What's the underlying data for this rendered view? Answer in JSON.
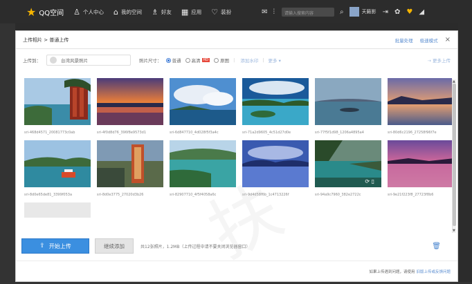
{
  "topbar": {
    "brand": "QQ空间",
    "items": [
      {
        "icon": "person-icon",
        "label": "个人中心"
      },
      {
        "icon": "home-icon",
        "label": "我的空间"
      },
      {
        "icon": "friends-icon",
        "label": "好友"
      },
      {
        "icon": "apps-icon",
        "label": "应用"
      },
      {
        "icon": "heart-outline-icon",
        "label": "装扮"
      }
    ],
    "search_placeholder": "请输入搜索内容",
    "user_name": "天籁影"
  },
  "dialog": {
    "breadcrumb": "上传相片 > 普通上传",
    "head_links": [
      "批量处理",
      "极速模式"
    ],
    "close_label": "×",
    "options": {
      "upload_to_label": "上传到：",
      "album_name": "台湾风景照片",
      "size_label": "照片尺寸：",
      "radios": [
        {
          "label": "普通",
          "selected": true
        },
        {
          "label": "高清",
          "badge": "HD",
          "selected": false
        },
        {
          "label": "原图",
          "selected": false
        }
      ],
      "link1": "添加水印",
      "link2": "更多",
      "more_upload": "更多上传"
    },
    "photos": [
      {
        "name": "sri-468d4571_20081773c0ab"
      },
      {
        "name": "sri-4f0d8d76_396f8e9573d1"
      },
      {
        "name": "sri-6d847710_4d028f5f3a4c"
      },
      {
        "name": "sri-71a2d9605_4c51d27d0e"
      },
      {
        "name": "sri-77f5f1d98_1206a4895a4"
      },
      {
        "name": "sri-80d6c2196_27258f96f7e"
      },
      {
        "name": "sri-8d0e65de81_3399f053a"
      },
      {
        "name": "sri-8d0e3775_27020d3b26"
      },
      {
        "name": "sri-82907710_4f5f4058a6c"
      },
      {
        "name": "sri-9d4d58f6b_1c4713226f"
      },
      {
        "name": "sri-94a9c7960_382e2722c"
      },
      {
        "name": "sri-9e21f223f8_27723f8b6"
      }
    ],
    "start_button": "开始上传",
    "add_button": "继续添加",
    "status_text": "共12张照片，1.2MB（上传过程中请不要关闭浏览器窗口）",
    "footer_text": "如果上传遇到问题，请使用",
    "footer_link": "旧版上传或反馈问题"
  }
}
